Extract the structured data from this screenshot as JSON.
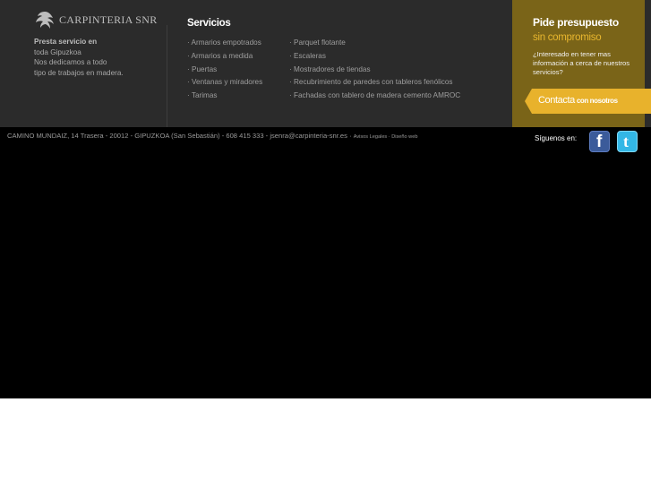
{
  "brand": {
    "name": "CARPINTERIA SNR"
  },
  "about": {
    "line1": "Presta servicio en",
    "line2": "toda Gipuzkoa",
    "line3": "Nos dedicamos a todo",
    "line4": "tipo de trabajos en madera."
  },
  "services": {
    "title": "Servicios",
    "col1": [
      "· Armarios empotrados",
      "· Armarios a medida",
      "· Puertas",
      "· Ventanas y miradores",
      "· Tarimas"
    ],
    "col2": [
      "· Parquet flotante",
      "· Escaleras",
      "· Mostradores de tiendas",
      "· Recubrimiento de paredes con tableros fenólicos",
      "· Fachadas con tablero de madera cemento AMROC"
    ]
  },
  "promo": {
    "title": "Pide presupuesto",
    "subtitle": "sin compromiso",
    "text": "¿Interesado en tener mas información a cerca de nuestros servicios?",
    "button_main": "Contacta",
    "button_sub": "con nosotros"
  },
  "bottom": {
    "address": "CAMINO MUNDAIZ, 14 Trasera - 20012 - GIPUZKOA (San Sebastián) - 608 415 333 - jsenra@carpinteria-snr.es · ",
    "legal": "Avisos Legales",
    "sep": " · ",
    "design": "Diseño web",
    "follow": "Síguenos en:"
  },
  "colors": {
    "promo_bg": "#7a6418",
    "accent": "#e8b22c",
    "footer_bg": "#2b2b2b"
  }
}
